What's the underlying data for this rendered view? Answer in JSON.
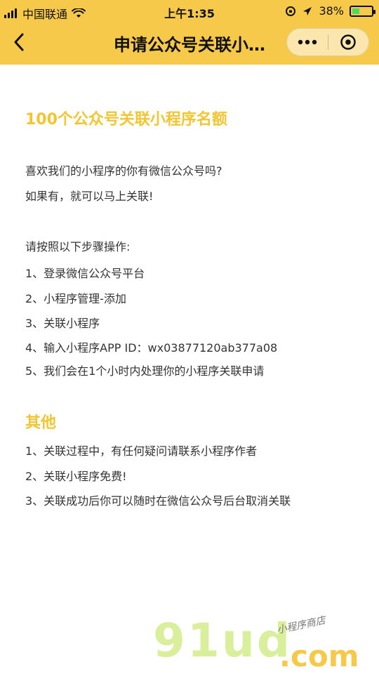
{
  "status_bar": {
    "carrier": "中国联通",
    "time": "上午1:35",
    "battery_percent": "38%",
    "battery_level": 0.38
  },
  "nav": {
    "title": "申请公众号关联小…"
  },
  "content": {
    "heading": "100个公众号关联小程序名额",
    "intro": [
      "喜欢我们的小程序的你有微信公众号吗?",
      "如果有，就可以马上关联!"
    ],
    "steps_title": "请按照以下步骤操作:",
    "steps": [
      "1、登录微信公众号平台",
      "2、小程序管理-添加",
      "3、关联小程序",
      "4、输入小程序APP ID：wx03877120ab377a08",
      "5、我们会在1个小时内处理你的小程序关联申请"
    ],
    "other_heading": "其他",
    "other": [
      "1、关联过程中，有任何疑问请联系小程序作者",
      "2、关联小程序免费!",
      "3、关联成功后你可以随时在微信公众号后台取消关联"
    ]
  },
  "watermark": {
    "text": "91ud",
    "domain": ".com",
    "tagline": "小程序商店"
  },
  "colors": {
    "topbar": "#f6c94a",
    "accent_heading": "#f2c531",
    "body_text": "#333333"
  }
}
